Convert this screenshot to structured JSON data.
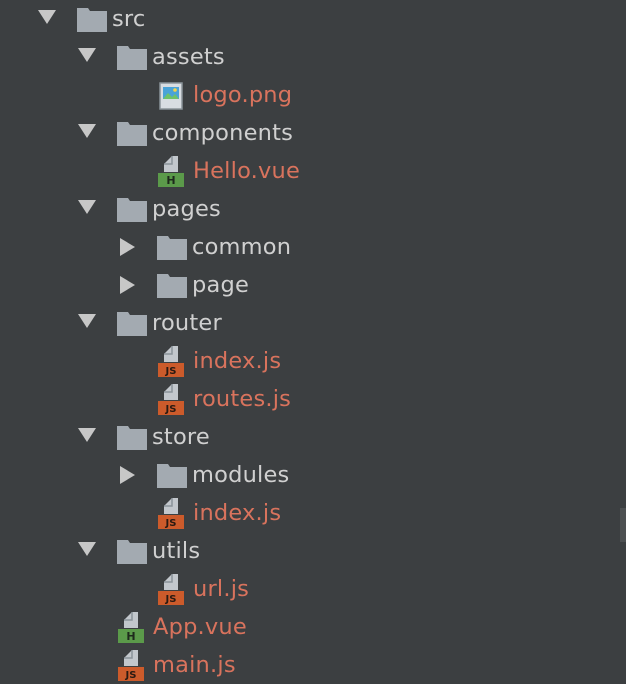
{
  "tree": {
    "rows": [
      {
        "label": "src",
        "kind": "folder",
        "state": "expanded"
      },
      {
        "label": "assets",
        "kind": "folder",
        "state": "expanded"
      },
      {
        "label": "logo.png",
        "kind": "file",
        "icon": "image-icon"
      },
      {
        "label": "components",
        "kind": "folder",
        "state": "expanded"
      },
      {
        "label": "Hello.vue",
        "kind": "file",
        "icon": "vue-file-icon",
        "badge": "H"
      },
      {
        "label": "pages",
        "kind": "folder",
        "state": "expanded"
      },
      {
        "label": "common",
        "kind": "folder",
        "state": "collapsed"
      },
      {
        "label": "page",
        "kind": "folder",
        "state": "collapsed"
      },
      {
        "label": "router",
        "kind": "folder",
        "state": "expanded"
      },
      {
        "label": "index.js",
        "kind": "file",
        "icon": "js-file-icon",
        "badge": "JS"
      },
      {
        "label": "routes.js",
        "kind": "file",
        "icon": "js-file-icon",
        "badge": "JS"
      },
      {
        "label": "store",
        "kind": "folder",
        "state": "expanded"
      },
      {
        "label": "modules",
        "kind": "folder",
        "state": "collapsed"
      },
      {
        "label": "index.js",
        "kind": "file",
        "icon": "js-file-icon",
        "badge": "JS"
      },
      {
        "label": "utils",
        "kind": "folder",
        "state": "expanded"
      },
      {
        "label": "url.js",
        "kind": "file",
        "icon": "js-file-icon",
        "badge": "JS"
      },
      {
        "label": "App.vue",
        "kind": "file",
        "icon": "vue-file-icon",
        "badge": "H"
      },
      {
        "label": "main.js",
        "kind": "file",
        "icon": "js-file-icon",
        "badge": "JS"
      }
    ]
  },
  "colors": {
    "background": "#3c3f41",
    "folder_text": "#d0d0d0",
    "modified_file_text": "#d9735d",
    "folder_icon": "#a3aab1",
    "arrow": "#c7c7c7",
    "js_badge": "#cc5b2b",
    "vue_badge": "#5b9a4a"
  }
}
